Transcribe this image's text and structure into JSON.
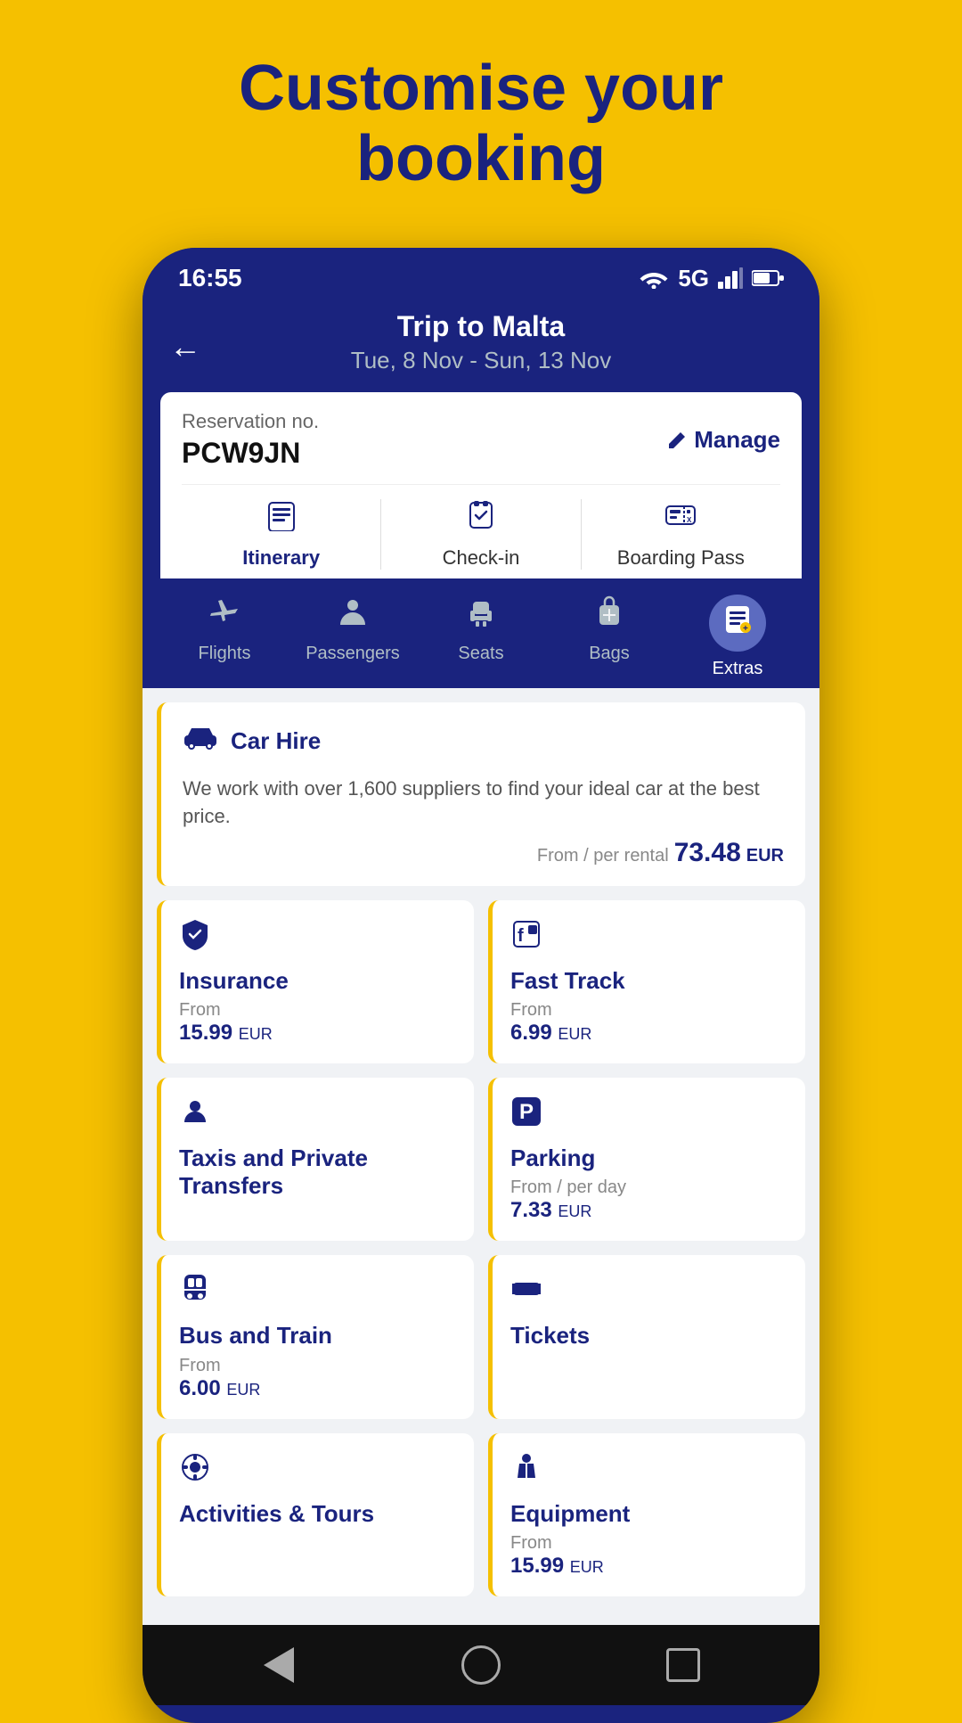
{
  "page": {
    "headline_line1": "Customise your",
    "headline_line2": "booking"
  },
  "status_bar": {
    "time": "16:55",
    "network": "5G"
  },
  "header": {
    "back_label": "←",
    "trip_title": "Trip to Malta",
    "trip_dates": "Tue, 8 Nov - Sun, 13 Nov"
  },
  "reservation": {
    "label": "Reservation no.",
    "number": "PCW9JN",
    "manage_label": "Manage"
  },
  "card_tabs": [
    {
      "id": "itinerary",
      "label": "Itinerary",
      "active": true
    },
    {
      "id": "checkin",
      "label": "Check-in",
      "active": false
    },
    {
      "id": "boarding_pass",
      "label": "Boarding Pass",
      "active": false
    }
  ],
  "bottom_nav": [
    {
      "id": "flights",
      "label": "Flights",
      "active": false
    },
    {
      "id": "passengers",
      "label": "Passengers",
      "active": false
    },
    {
      "id": "seats",
      "label": "Seats",
      "active": false
    },
    {
      "id": "bags",
      "label": "Bags",
      "active": false
    },
    {
      "id": "extras",
      "label": "Extras",
      "active": true
    }
  ],
  "services": {
    "car_hire": {
      "name": "Car Hire",
      "desc": "We work with over 1,600 suppliers to find your ideal car at the best price.",
      "from_label": "From / per rental",
      "price": "73.48",
      "currency": "EUR"
    },
    "insurance": {
      "name": "Insurance",
      "from_label": "From",
      "price": "15.99",
      "currency": "EUR"
    },
    "fast_track": {
      "name": "Fast Track",
      "from_label": "From",
      "price": "6.99",
      "currency": "EUR"
    },
    "taxis": {
      "name": "Taxis and Private Transfers",
      "from_label": "",
      "price": "",
      "currency": ""
    },
    "parking": {
      "name": "Parking",
      "from_label": "From / per day",
      "price": "7.33",
      "currency": "EUR"
    },
    "bus_train": {
      "name": "Bus and Train",
      "from_label": "From",
      "price": "6.00",
      "currency": "EUR"
    },
    "tickets": {
      "name": "Tickets",
      "from_label": "",
      "price": "",
      "currency": ""
    },
    "activities": {
      "name": "Activities & Tours",
      "from_label": "",
      "price": "",
      "currency": ""
    },
    "equipment": {
      "name": "Equipment",
      "from_label": "From",
      "price": "15.99",
      "currency": "EUR"
    }
  },
  "phone_nav": {
    "back": "◀",
    "home": "",
    "recent": ""
  }
}
